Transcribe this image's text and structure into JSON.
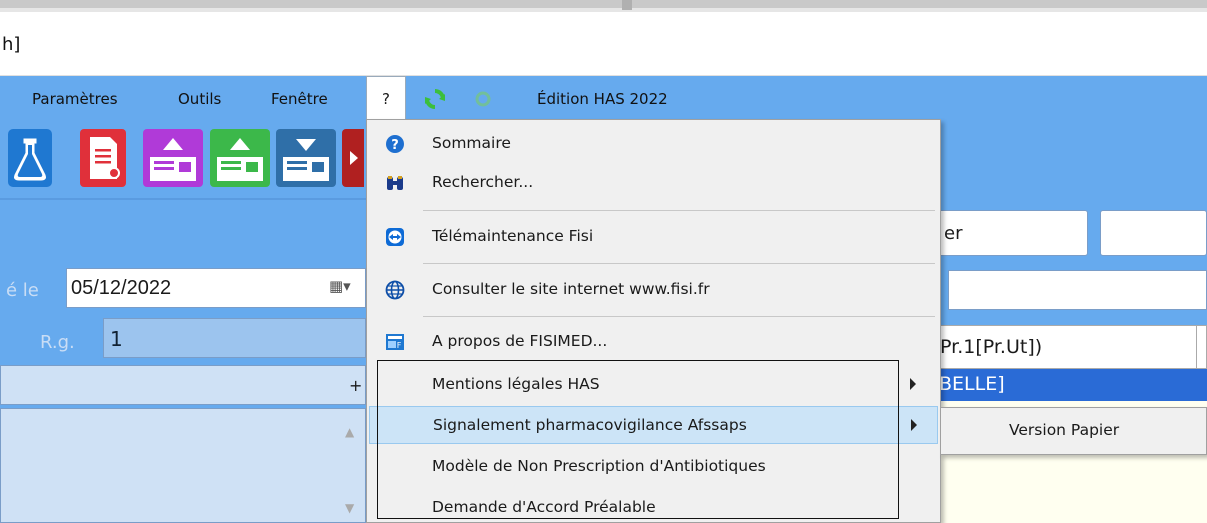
{
  "window": {
    "title_fragment": "h]"
  },
  "menu": {
    "items": [
      "Paramètres",
      "Outils",
      "Fenêtre"
    ],
    "help": "?",
    "edition": "Édition HAS 2022"
  },
  "toolbar": {
    "buttons": [
      "flask-icon",
      "document-red-icon",
      "upload-purple-icon",
      "upload-green-icon",
      "download-blue-icon"
    ]
  },
  "form": {
    "date_label": "é le",
    "date_value": "05/12/2022",
    "rg_label": "R.g.",
    "rg_value": "1",
    "plus": "+",
    "right_field_fragment": "er"
  },
  "grid": {
    "header": "Pr.1[Pr.Ut])",
    "selected_row": "BELLE]"
  },
  "dropdown": {
    "items": [
      {
        "label": "Sommaire",
        "icon": "help-circle-icon"
      },
      {
        "label": "Rechercher...",
        "icon": "binoculars-icon"
      },
      {
        "label": "Télémaintenance Fisi",
        "icon": "teamviewer-icon"
      },
      {
        "label": "Consulter le site internet www.fisi.fr",
        "icon": "globe-icon"
      },
      {
        "label": "A propos de FISIMED...",
        "icon": "app-info-icon"
      },
      {
        "label": "Mentions légales HAS",
        "has_submenu": true
      },
      {
        "label": "Signalement pharmacovigilance Afssaps",
        "has_submenu": true,
        "highlighted": true
      },
      {
        "label": "Modèle de Non Prescription d'Antibiotiques"
      },
      {
        "label": "Demande d'Accord Préalable"
      }
    ]
  },
  "submenu": {
    "items": [
      "Version Papier"
    ]
  },
  "colors": {
    "app_blue": "#66aaee",
    "highlight": "#cce4f7",
    "selection": "#2a6bd6"
  }
}
